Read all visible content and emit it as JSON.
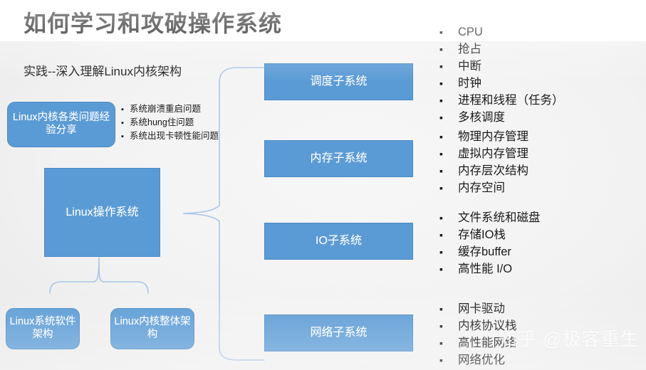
{
  "slide": {
    "title": "如何学习和攻破操作系统",
    "subtitle": "实践--深入理解Linux内核架构",
    "watermark": "知乎 @极客重生",
    "colors": {
      "box_fill": "#5b9bd5",
      "box_border": "#4a8ac4",
      "box_text": "#ffffff",
      "connector": "#a9c6e8",
      "background_top": "#ffffff",
      "background_body": "#f2f2f2",
      "body_text": "#1a1a1a"
    }
  },
  "left": {
    "issue_box": "Linux内核各类问题经验分享",
    "issue_bullets": [
      "系统崩溃重启问题",
      "系统hung住问题",
      "系统出现卡顿性能问题"
    ],
    "os_box": "Linux操作系统",
    "arch_boxes": [
      "Linux系统软件架构",
      "Linux内核整体架构"
    ],
    "bullet_glyph": "▪"
  },
  "subsystems": [
    {
      "label": "调度子系统",
      "topics": [
        "CPU",
        "抢占",
        "中断",
        "时钟",
        "进程和线程（任务）",
        "多核调度"
      ]
    },
    {
      "label": "内存子系统",
      "topics": [
        "物理内存管理",
        "虚拟内存管理",
        "内存层次结构",
        "内存空间"
      ]
    },
    {
      "label": "IO子系统",
      "topics": [
        "文件系统和磁盘",
        "存储IO栈",
        "缓存buffer",
        "高性能 I/O"
      ]
    },
    {
      "label": "网络子系统",
      "topics": [
        "网卡驱动",
        "内核协议栈",
        "高性能网络",
        "网络优化"
      ]
    }
  ],
  "list_bullet_glyph": "▪"
}
